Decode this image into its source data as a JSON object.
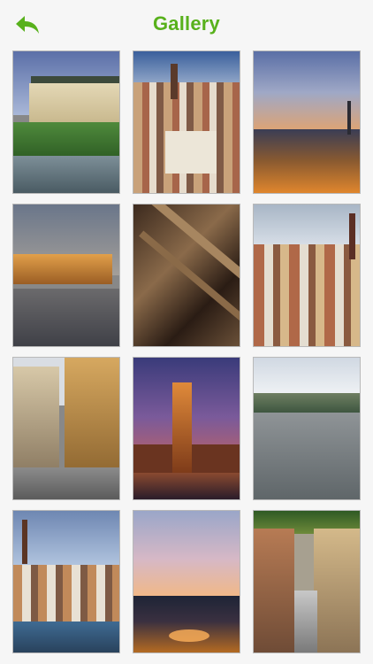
{
  "header": {
    "title": "Gallery",
    "back_icon": "back-arrow-icon",
    "accent_color": "#58b11c"
  },
  "gallery": {
    "items": [
      {
        "scene": "s1"
      },
      {
        "scene": "s2"
      },
      {
        "scene": "s3"
      },
      {
        "scene": "s4"
      },
      {
        "scene": "s5"
      },
      {
        "scene": "s6"
      },
      {
        "scene": "s7"
      },
      {
        "scene": "s8"
      },
      {
        "scene": "s9"
      },
      {
        "scene": "s10"
      },
      {
        "scene": "s11"
      },
      {
        "scene": "s12"
      }
    ]
  }
}
